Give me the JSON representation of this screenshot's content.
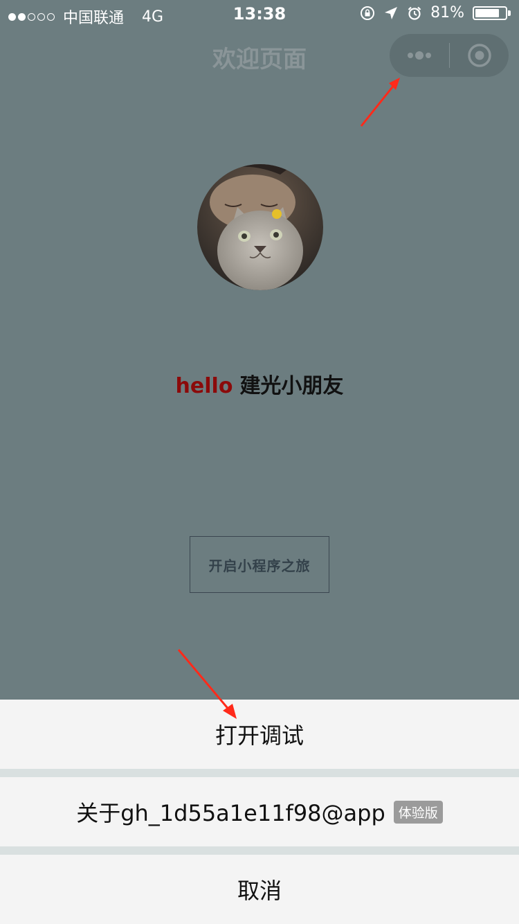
{
  "status_bar": {
    "carrier": "中国联通",
    "network": "4G",
    "time": "13:38",
    "battery_percent": "81%",
    "battery_level": 0.81
  },
  "nav": {
    "title": "欢迎页面"
  },
  "main": {
    "greeting_hello": "hello",
    "greeting_name": "建光小朋友",
    "start_button": "开启小程序之旅"
  },
  "action_sheet": {
    "debug_label": "打开调试",
    "about_label": "关于gh_1d55a1e11f98@app",
    "about_badge": "体验版",
    "cancel_label": "取消"
  },
  "colors": {
    "overlay_bg": "#6c7d80",
    "hello": "#8b0a0a",
    "annotation_arrow": "#ff2a1a"
  }
}
